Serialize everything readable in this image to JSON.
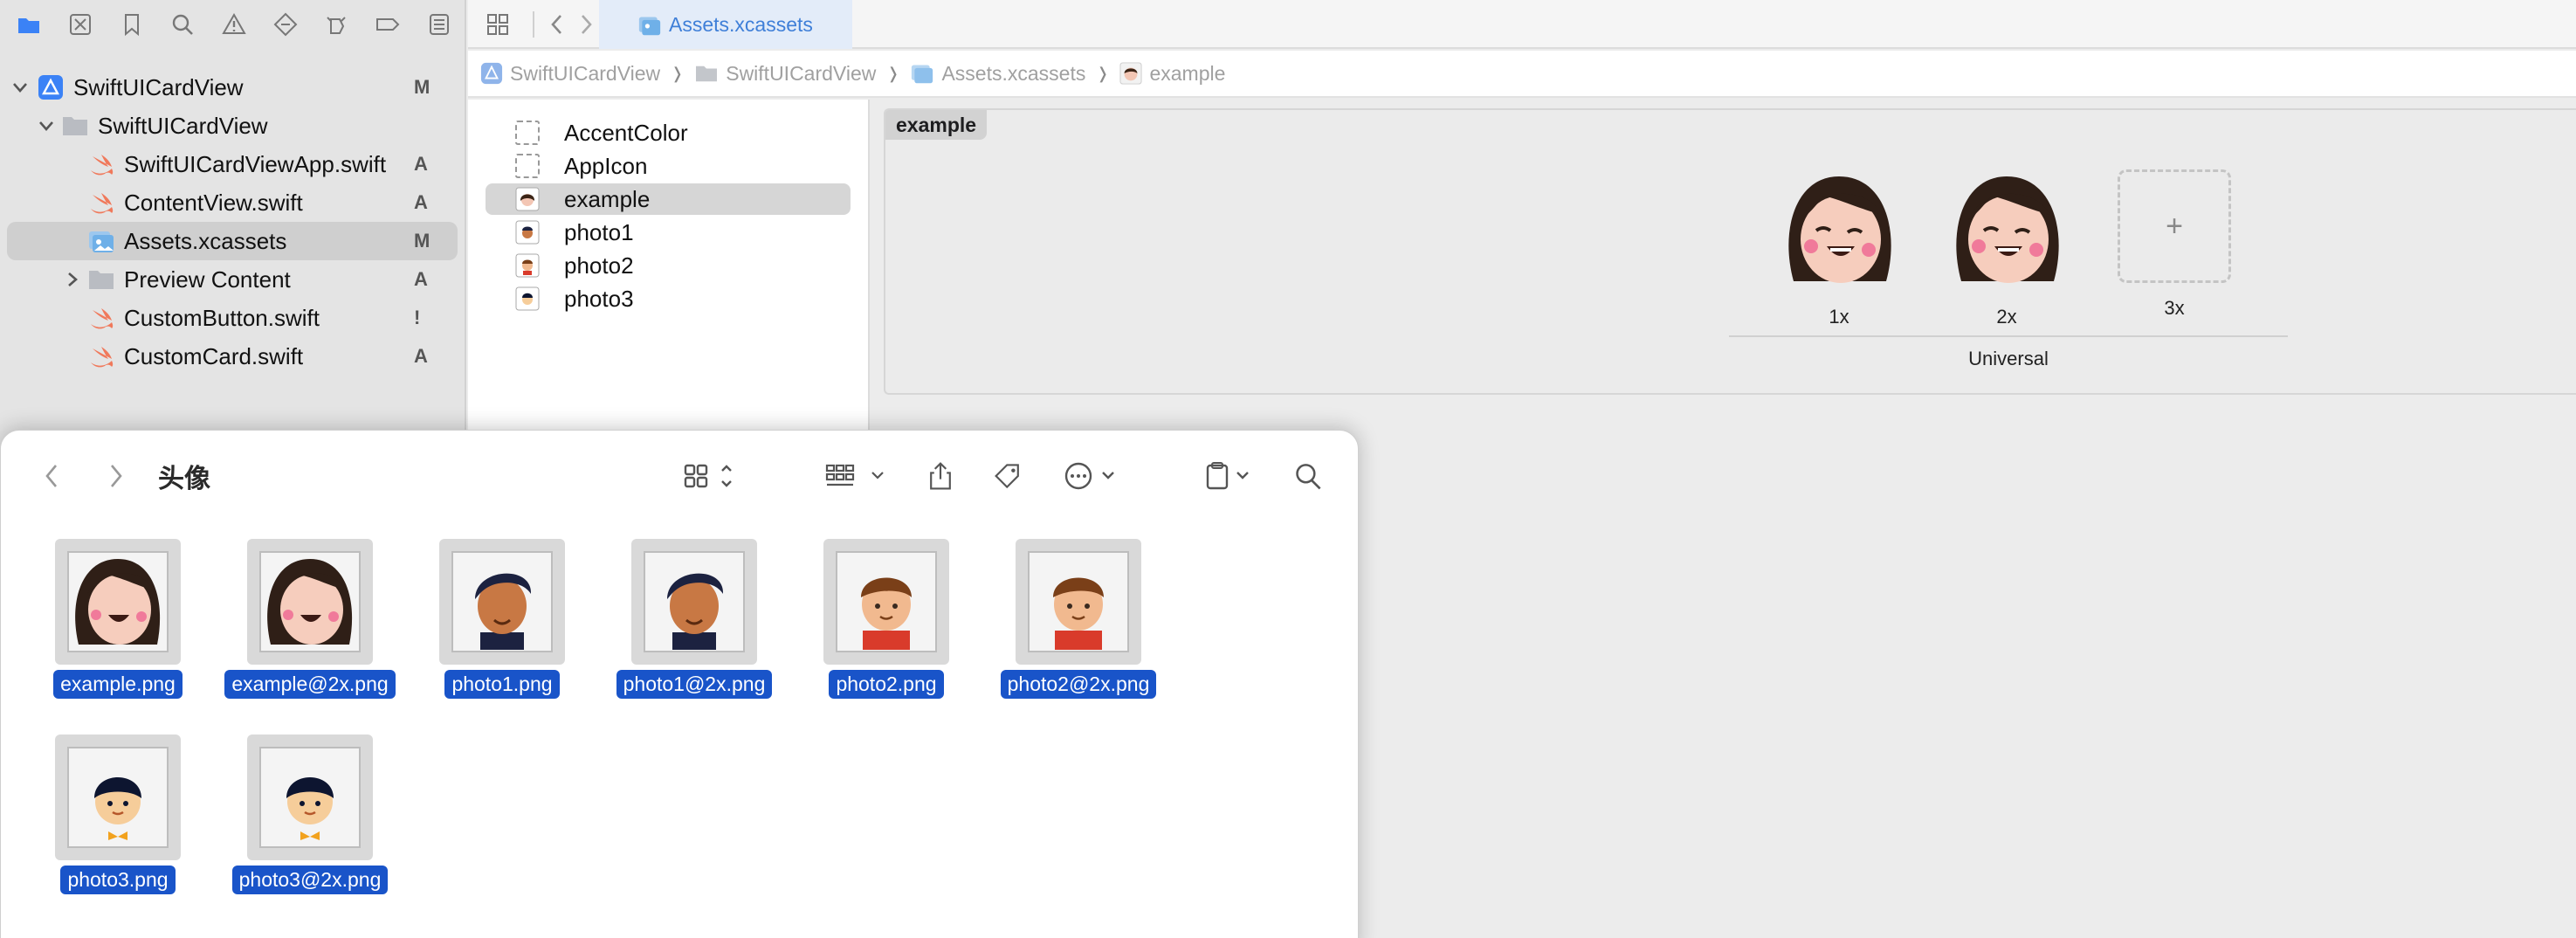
{
  "navigator": {
    "toolbar_icons": [
      "folder-icon",
      "source-control-icon",
      "bookmark-icon",
      "search-icon",
      "warning-icon",
      "test-icon",
      "debug-icon",
      "breakpoint-icon",
      "report-icon"
    ],
    "items": [
      {
        "label": "SwiftUICardView",
        "badge": "M",
        "icon": "project-icon",
        "chevron": "down"
      },
      {
        "label": "SwiftUICardView",
        "badge": "",
        "icon": "folder-icon",
        "chevron": "down"
      },
      {
        "label": "SwiftUICardViewApp.swift",
        "badge": "A",
        "icon": "swift-file-icon",
        "chevron": ""
      },
      {
        "label": "ContentView.swift",
        "badge": "A",
        "icon": "swift-file-icon",
        "chevron": ""
      },
      {
        "label": "Assets.xcassets",
        "badge": "M",
        "icon": "assets-icon",
        "chevron": ""
      },
      {
        "label": "Preview Content",
        "badge": "A",
        "icon": "folder-icon",
        "chevron": "right"
      },
      {
        "label": "CustomButton.swift",
        "badge": "!",
        "icon": "swift-file-icon",
        "chevron": ""
      },
      {
        "label": "CustomCard.swift",
        "badge": "A",
        "icon": "swift-file-icon",
        "chevron": ""
      }
    ]
  },
  "tabbar": {
    "active_tab": "Assets.xcassets"
  },
  "jumpbar": {
    "crumbs": [
      "SwiftUICardView",
      "SwiftUICardView",
      "Assets.xcassets",
      "example"
    ]
  },
  "asset_list": {
    "items": [
      "AccentColor",
      "AppIcon",
      "example",
      "photo1",
      "photo2",
      "photo3"
    ],
    "selected": "example"
  },
  "image_set": {
    "name": "example",
    "slots": [
      "1x",
      "2x",
      "3x"
    ],
    "add_symbol": "+",
    "group_label": "Universal"
  },
  "finder": {
    "title": "头像",
    "files": [
      "example.png",
      "example@2x.png",
      "photo1.png",
      "photo1@2x.png",
      "photo2.png",
      "photo2@2x.png",
      "photo3.png",
      "photo3@2x.png"
    ]
  },
  "colors": {
    "selection_blue": "#1954c9",
    "xcode_accent": "#3f7fd8",
    "swift_orange": "#f05138"
  }
}
